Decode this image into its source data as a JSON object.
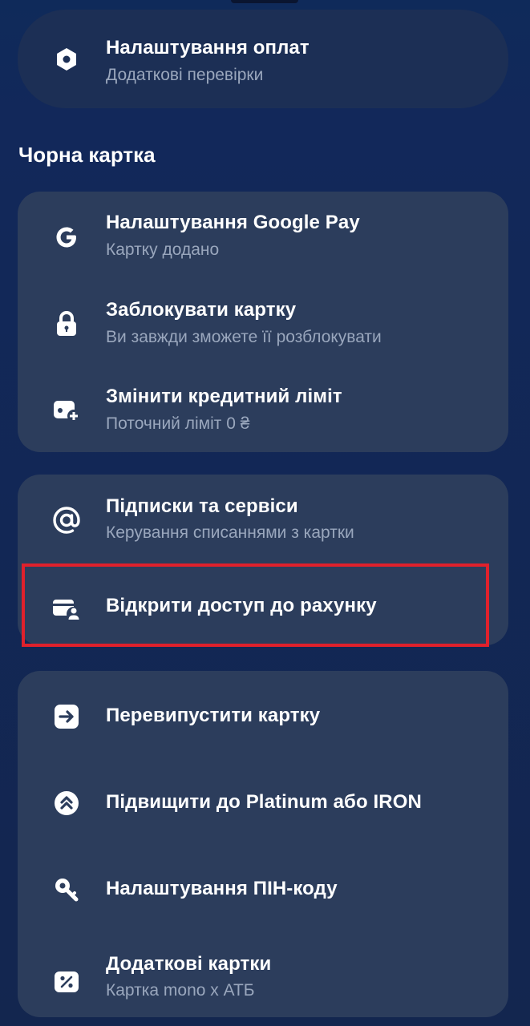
{
  "top_card": {
    "title": "Налаштування оплат",
    "subtitle": "Додаткові перевірки",
    "icon": "shield-hexagon-icon"
  },
  "section": {
    "title": "Чорна картка"
  },
  "group1": [
    {
      "title": "Налаштування Google Pay",
      "subtitle": "Картку додано",
      "icon": "google-icon"
    },
    {
      "title": "Заблокувати картку",
      "subtitle": "Ви завжди зможете її розблокувати",
      "icon": "lock-icon"
    },
    {
      "title": "Змінити кредитний ліміт",
      "subtitle": "Поточний ліміт 0 ₴",
      "icon": "card-plus-icon"
    }
  ],
  "group2": [
    {
      "title": "Підписки та сервіси",
      "subtitle": "Керування списаннями з картки",
      "icon": "at-icon"
    },
    {
      "title": "Відкрити доступ до рахунку",
      "icon": "card-user-icon"
    }
  ],
  "group3": [
    {
      "title": "Перевипустити картку",
      "icon": "arrow-right-icon"
    },
    {
      "title": "Підвищити до Platinum або IRON",
      "icon": "chevrons-up-icon"
    },
    {
      "title": "Налаштування ПІН-коду",
      "icon": "key-icon"
    },
    {
      "title": "Додаткові картки",
      "subtitle": "Картка mono x АТБ",
      "icon": "percent-icon"
    }
  ],
  "colors": {
    "background": "#13264f",
    "card": "#2c3d5c",
    "top_card": "#1c2f55",
    "subtitle": "#9aa7bd",
    "highlight": "#e0212c"
  }
}
